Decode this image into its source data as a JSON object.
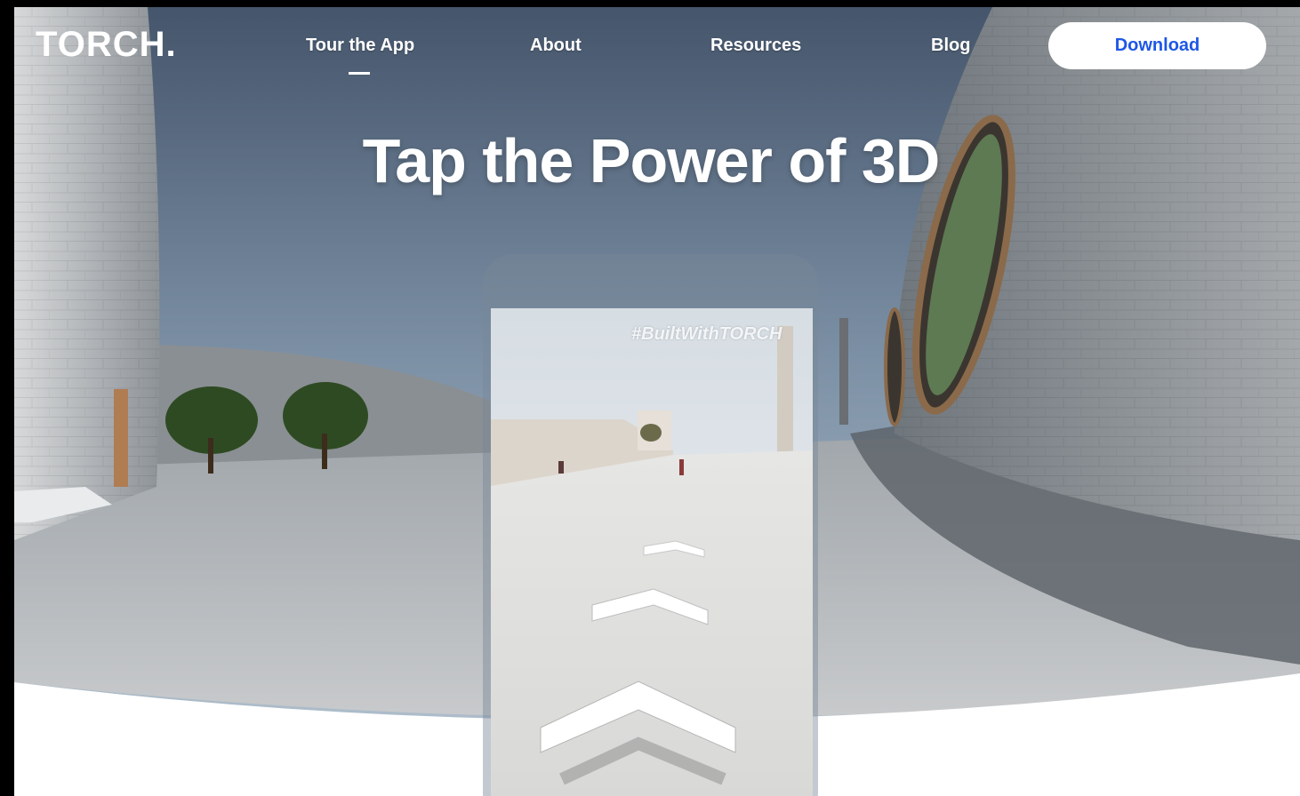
{
  "brand": {
    "name": "TORCH",
    "dot": "."
  },
  "nav": {
    "links": [
      {
        "label": "Tour the App",
        "active": true
      },
      {
        "label": "About",
        "active": false
      },
      {
        "label": "Resources",
        "active": false
      },
      {
        "label": "Blog",
        "active": false
      }
    ],
    "download_label": "Download"
  },
  "hero": {
    "title": "Tap the Power of 3D"
  },
  "phone": {
    "hashtag": "#BuiltWithTORCH"
  },
  "colors": {
    "accent": "#1e57e6",
    "sky_top": "#45556b",
    "pavement": "#b9bcbe"
  }
}
